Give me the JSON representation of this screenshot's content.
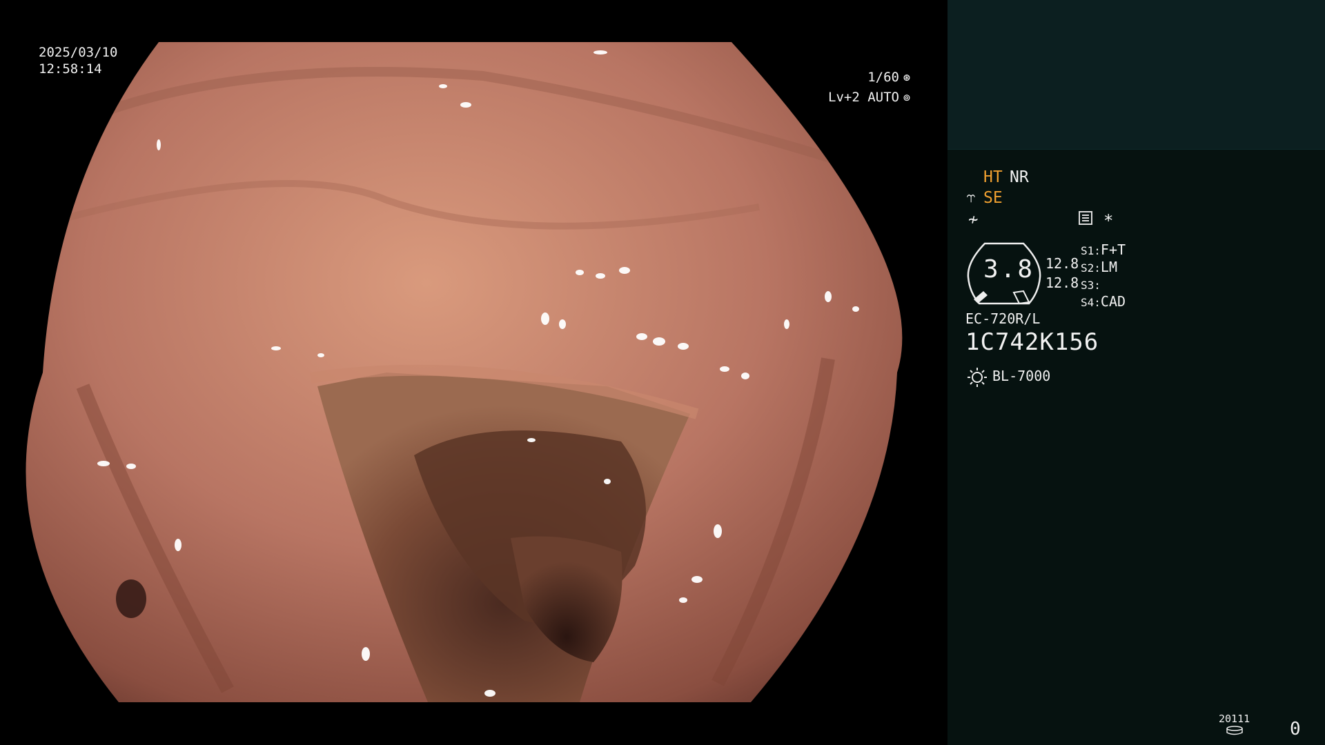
{
  "overlay": {
    "date": "2025/03/10",
    "time": "12:58:14",
    "shutter": "1/60",
    "shutter_icon": "shutter-icon",
    "exposure": "Lv+2 AUTO",
    "exposure_icon": "auto-exposure-icon"
  },
  "panel": {
    "mode_ht": "HT",
    "mode_nr": "NR",
    "mode_se": "SE",
    "mode_se_icon": "scope-tip-icon",
    "freeze_icon": "freeze-icon",
    "menu_icon": "menu-icon",
    "star": "*",
    "dial_value": "3.8",
    "readout_1": "12.8",
    "readout_2": "12.8",
    "switches": [
      {
        "key": "S1:",
        "value": "F+T"
      },
      {
        "key": "S2:",
        "value": "LM"
      },
      {
        "key": "S3:",
        "value": ""
      },
      {
        "key": "S4:",
        "value": "CAD"
      }
    ],
    "scope_model": "EC-720R/L",
    "scope_serial": "1C742K156",
    "light_source_icon": "light-source-icon",
    "light_source": "BL-7000",
    "counter_label": "20111",
    "counter_icon": "storage-icon",
    "counter_value": "0"
  },
  "colors": {
    "panel_bg": "#061210",
    "panel_top_bg": "#0c1f20",
    "accent_orange": "#f0a030",
    "text": "#f2f2f2"
  }
}
